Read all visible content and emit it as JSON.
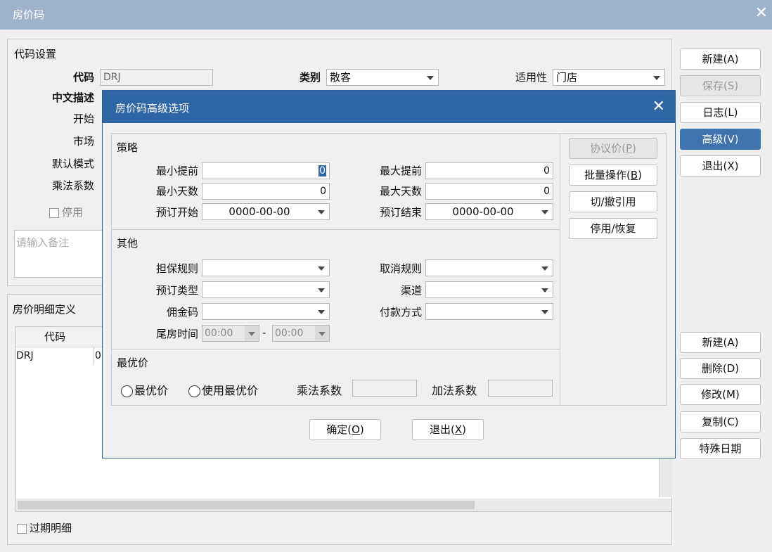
{
  "window": {
    "title": "房价码"
  },
  "code_settings": {
    "group_title": "代码设置",
    "code_label": "代码",
    "code_value": "DRJ",
    "category_label": "类别",
    "category_value": "散客",
    "applicability_label": "适用性",
    "applicability_value": "门店",
    "desc_label": "中文描述",
    "start_label": "开始",
    "market_label": "市场",
    "default_mode_label": "默认模式",
    "multiplier_label": "乘法系数",
    "disable_label": "停用",
    "remark_placeholder": "请输入备注"
  },
  "right_buttons": {
    "new": "新建(A)",
    "save": "保存(S)",
    "log": "日志(L)",
    "advanced": "高级(V)",
    "exit": "退出(X)"
  },
  "detail": {
    "group_title": "房价明细定义",
    "col_code": "代码",
    "row_code": "DRJ",
    "row_next": "0",
    "expired_label": "过期明细"
  },
  "detail_buttons": {
    "new": "新建(A)",
    "delete": "删除(D)",
    "modify": "修改(M)",
    "copy": "复制(C)",
    "special": "特殊日期"
  },
  "dialog": {
    "title": "房价码高级选项",
    "strategy": {
      "title": "策略",
      "min_advance_label": "最小提前",
      "min_advance_value": "0",
      "max_advance_label": "最大提前",
      "max_advance_value": "0",
      "min_days_label": "最小天数",
      "min_days_value": "0",
      "max_days_label": "最大天数",
      "max_days_value": "0",
      "book_start_label": "预订开始",
      "book_start_value": "0000-00-00",
      "book_end_label": "预订结束",
      "book_end_value": "0000-00-00"
    },
    "other": {
      "title": "其他",
      "guarantee_label": "担保规则",
      "cancel_label": "取消规则",
      "book_type_label": "预订类型",
      "channel_label": "渠道",
      "commission_label": "佣金码",
      "payment_label": "付款方式",
      "tail_time_label": "尾房时间",
      "tail_from": "00:00",
      "tail_sep": "-",
      "tail_to": "00:00"
    },
    "best": {
      "title": "最优价",
      "opt1": "最优价",
      "opt2": "使用最优价",
      "mult_label": "乘法系数",
      "add_label": "加法系数"
    },
    "side_buttons": {
      "agreement_main": "协议价(",
      "agreement_key": "P",
      "batch_main": "批量操作(",
      "batch_key": "B",
      "toggle_ref": "切/撤引用",
      "disable_restore": "停用/恢复"
    },
    "ok_main": "确定(",
    "ok_key": "O",
    "exit_main": "退出(",
    "exit_key": "X",
    "paren_close": ")"
  }
}
